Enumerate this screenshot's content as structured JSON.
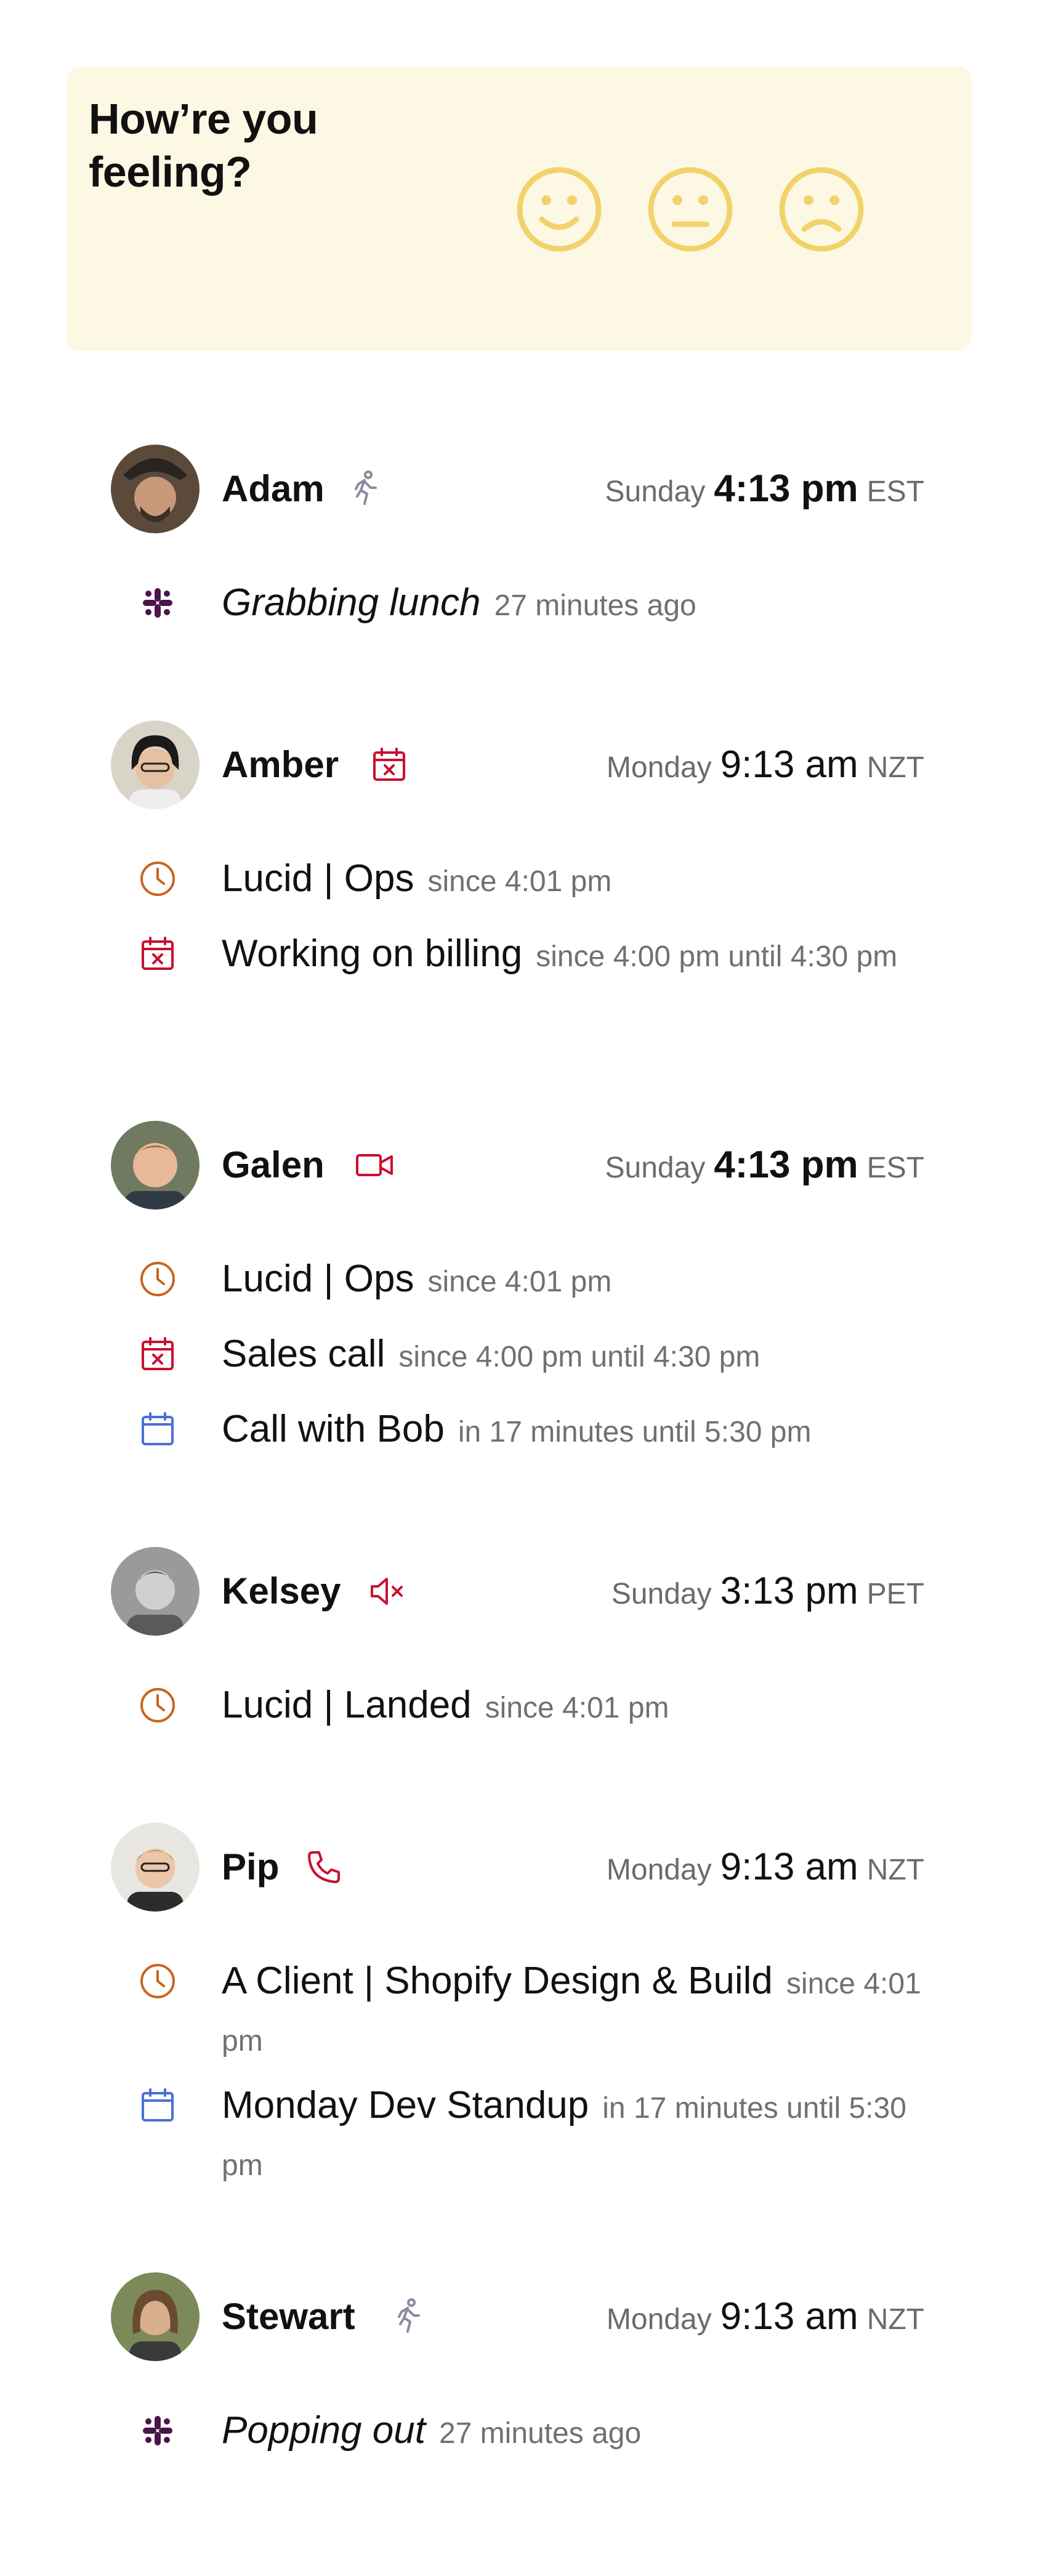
{
  "feeling": {
    "question": "How’re you feeling?",
    "faces": [
      "happy-face",
      "neutral-face",
      "sad-face"
    ],
    "accent": "#f2d36b"
  },
  "people": [
    {
      "name": "Adam",
      "status_icon": "walking-icon",
      "day": "Sunday",
      "time": "4:13 pm",
      "tz": "EST",
      "time_bold": true,
      "rows": [
        {
          "icon": "slack-icon",
          "text": "Grabbing lunch",
          "meta": "27 minutes ago",
          "italic": true
        }
      ]
    },
    {
      "name": "Amber",
      "status_icon": "calendar-busy-icon",
      "day": "Monday",
      "time": "9:13 am",
      "tz": "NZT",
      "time_bold": false,
      "rows": [
        {
          "icon": "clock-icon",
          "text": "Lucid | Ops",
          "meta": "since 4:01 pm"
        },
        {
          "icon": "calendar-busy-icon",
          "text": "Working on billing",
          "meta": "since 4:00 pm until 4:30 pm"
        }
      ]
    },
    {
      "name": "Galen",
      "status_icon": "video-icon",
      "day": "Sunday",
      "time": "4:13 pm",
      "tz": "EST",
      "time_bold": true,
      "rows": [
        {
          "icon": "clock-icon",
          "text": "Lucid | Ops",
          "meta": "since 4:01 pm"
        },
        {
          "icon": "calendar-busy-icon",
          "text": "Sales call",
          "meta": "since 4:00 pm until 4:30 pm"
        },
        {
          "icon": "calendar-icon",
          "text": "Call with Bob",
          "meta": "in 17 minutes until 5:30 pm"
        }
      ]
    },
    {
      "name": "Kelsey",
      "status_icon": "muted-icon",
      "day": "Sunday",
      "time": "3:13 pm",
      "tz": "PET",
      "time_bold": false,
      "rows": [
        {
          "icon": "clock-icon",
          "text": "Lucid | Landed",
          "meta": "since 4:01 pm"
        }
      ]
    },
    {
      "name": "Pip",
      "status_icon": "phone-icon",
      "day": "Monday",
      "time": "9:13 am",
      "tz": "NZT",
      "time_bold": false,
      "rows": [
        {
          "icon": "clock-icon",
          "text": "A Client | Shopify Design & Build",
          "meta": "since 4:01 pm"
        },
        {
          "icon": "calendar-icon",
          "text": "Monday Dev Standup",
          "meta": "in 17 minutes until 5:30 pm"
        }
      ]
    },
    {
      "name": "Stewart",
      "status_icon": "walking-icon",
      "day": "Monday",
      "time": "9:13 am",
      "tz": "NZT",
      "time_bold": false,
      "rows": [
        {
          "icon": "slack-icon",
          "text": "Popping out",
          "meta": "27 minutes ago",
          "italic": true
        }
      ]
    }
  ],
  "colors": {
    "busy": "#c8102e",
    "clock": "#c8641e",
    "calendar": "#4a6fd6",
    "slack": "#4a154b",
    "walking": "#8a8aa0"
  }
}
